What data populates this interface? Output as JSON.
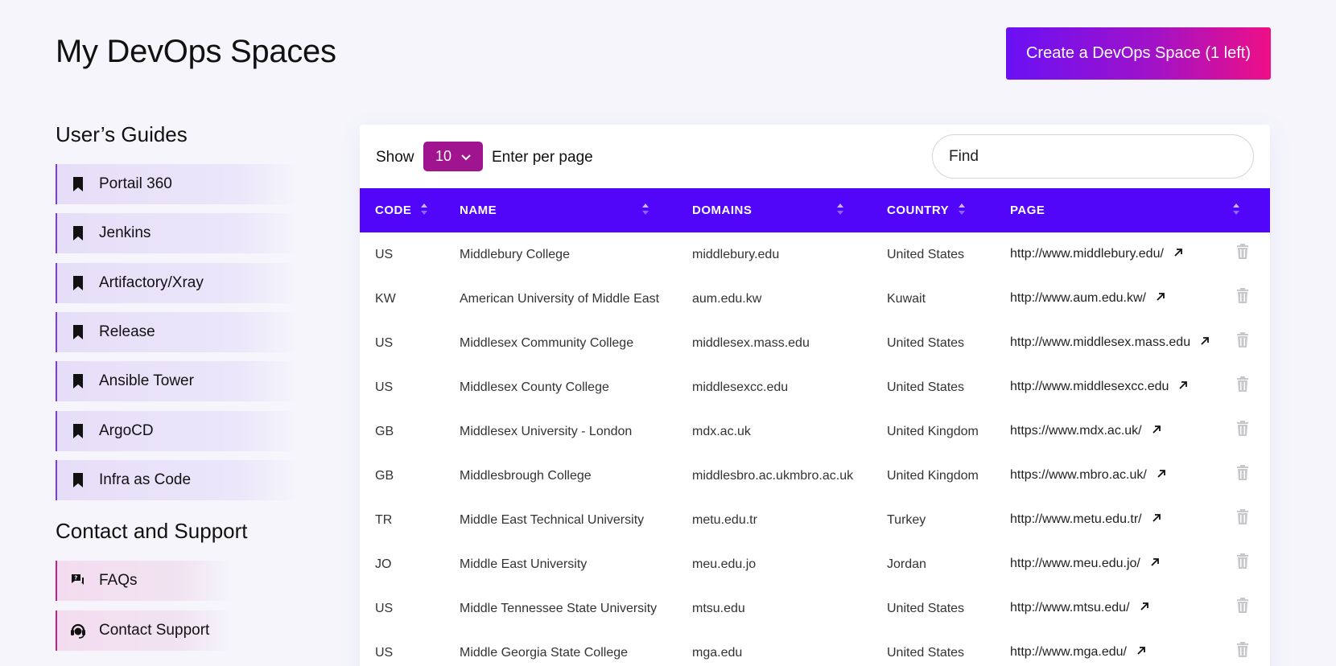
{
  "header": {
    "title": "My DevOps Spaces",
    "create_button": "Create a DevOps Space (1 left)"
  },
  "sidebar": {
    "guides_title": "User’s Guides",
    "guides": [
      {
        "label": "Portail 360",
        "icon": "bookmark-icon"
      },
      {
        "label": "Jenkins",
        "icon": "bookmark-icon"
      },
      {
        "label": "Artifactory/Xray",
        "icon": "bookmark-icon"
      },
      {
        "label": "Release",
        "icon": "bookmark-icon"
      },
      {
        "label": "Ansible Tower",
        "icon": "bookmark-icon"
      },
      {
        "label": "ArgoCD",
        "icon": "bookmark-icon"
      },
      {
        "label": "Infra as Code",
        "icon": "bookmark-icon"
      }
    ],
    "support_title": "Contact and Support",
    "support": [
      {
        "label": "FAQs",
        "icon": "faq-chat-icon"
      },
      {
        "label": "Contact Support",
        "icon": "headset-icon"
      }
    ]
  },
  "table_controls": {
    "show_label": "Show",
    "per_page_value": "10",
    "per_page_suffix": "Enter per page",
    "find_placeholder": "Find"
  },
  "table": {
    "columns": [
      "CODE",
      "NAME",
      "DOMAINS",
      "COUNTRY",
      "PAGE"
    ],
    "rows": [
      {
        "code": "US",
        "name": "Middlebury College",
        "domain": "middlebury.edu",
        "country": "United States",
        "page": "http://www.middlebury.edu/"
      },
      {
        "code": "KW",
        "name": "American University of Middle East",
        "domain": "aum.edu.kw",
        "country": "Kuwait",
        "page": "http://www.aum.edu.kw/"
      },
      {
        "code": "US",
        "name": "Middlesex Community College",
        "domain": "middlesex.mass.edu",
        "country": "United States",
        "page": "http://www.middlesex.mass.edu"
      },
      {
        "code": "US",
        "name": "Middlesex County College",
        "domain": "middlesexcc.edu",
        "country": "United States",
        "page": "http://www.middlesexcc.edu"
      },
      {
        "code": "GB",
        "name": "Middlesex University - London",
        "domain": "mdx.ac.uk",
        "country": "United Kingdom",
        "page": "https://www.mdx.ac.uk/"
      },
      {
        "code": "GB",
        "name": "Middlesbrough College",
        "domain": "middlesbro.ac.ukmbro.ac.uk",
        "country": "United Kingdom",
        "page": "https://www.mbro.ac.uk/"
      },
      {
        "code": "TR",
        "name": "Middle East Technical University",
        "domain": "metu.edu.tr",
        "country": "Turkey",
        "page": "http://www.metu.edu.tr/"
      },
      {
        "code": "JO",
        "name": "Middle East University",
        "domain": "meu.edu.jo",
        "country": "Jordan",
        "page": "http://www.meu.edu.jo/"
      },
      {
        "code": "US",
        "name": "Middle Tennessee State University",
        "domain": "mtsu.edu",
        "country": "United States",
        "page": "http://www.mtsu.edu/"
      },
      {
        "code": "US",
        "name": "Middle Georgia State College",
        "domain": "mga.edu",
        "country": "United States",
        "page": "http://www.mga.edu/"
      }
    ]
  },
  "colors": {
    "header_row": "#5106f9",
    "per_page_bg": "#a0148f",
    "button_gradient_start": "#6a10f5",
    "button_gradient_end": "#ee0f86",
    "trash": "#c8c8cc"
  }
}
